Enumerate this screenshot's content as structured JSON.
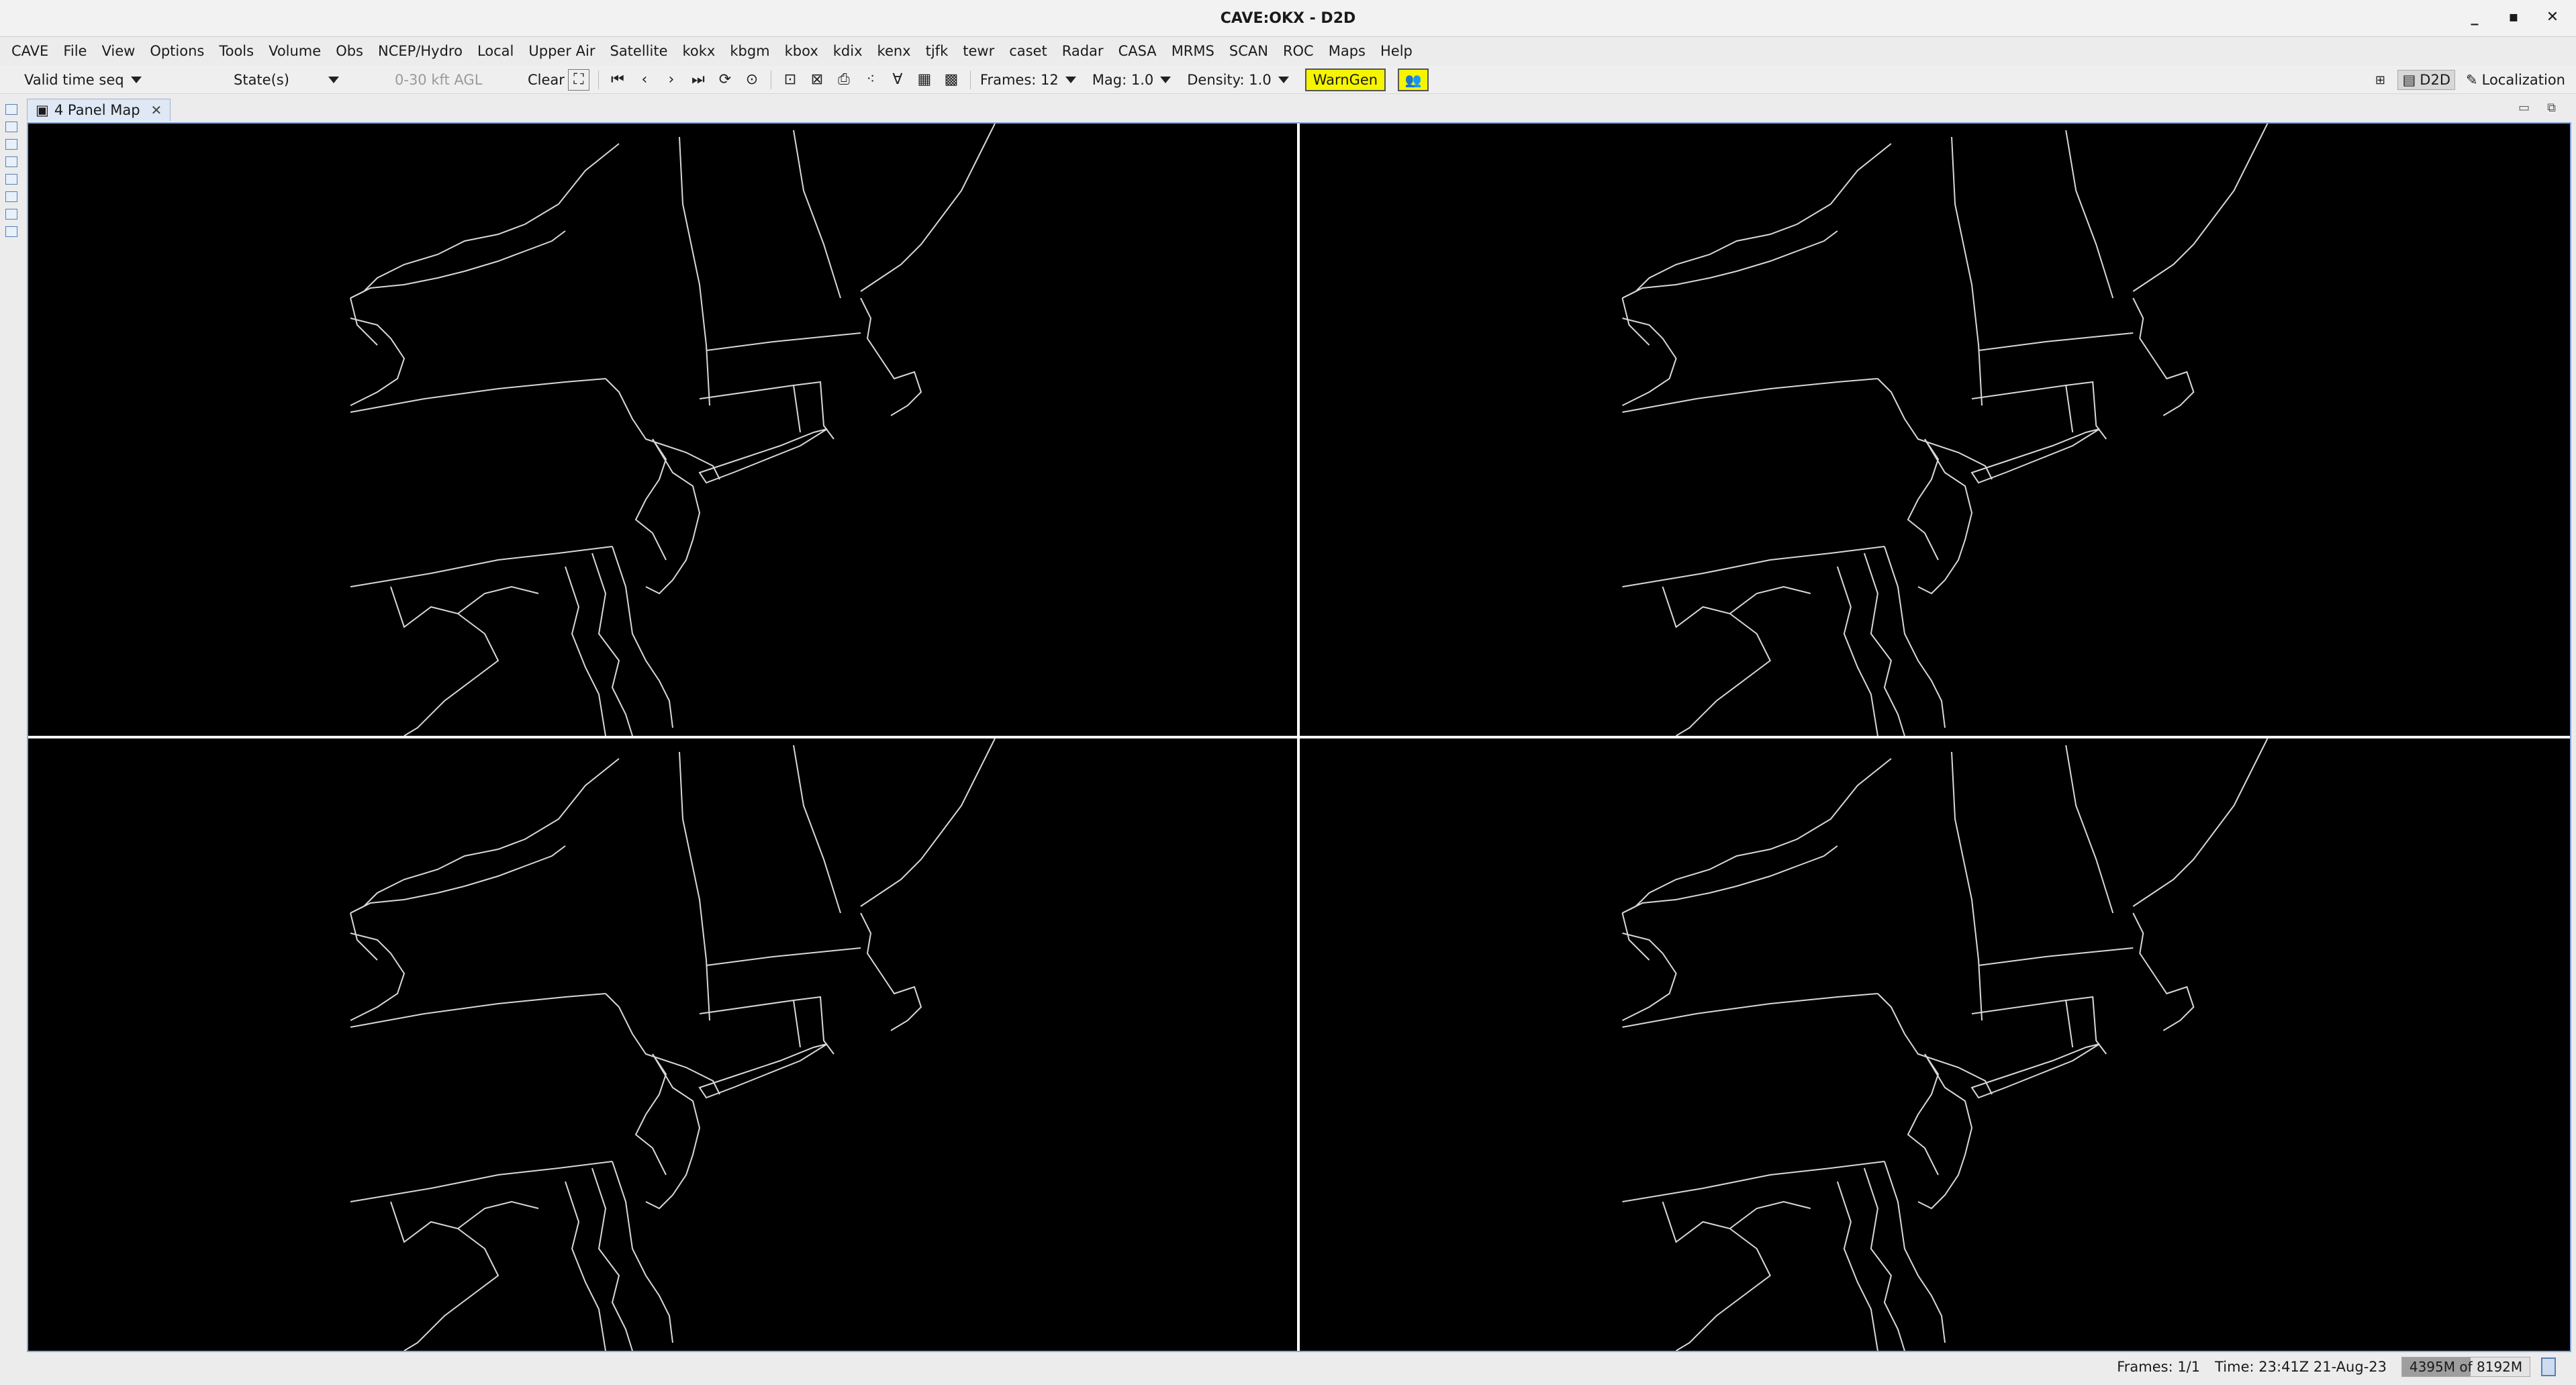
{
  "window": {
    "title": "CAVE:OKX - D2D",
    "controls": [
      "minimize",
      "maximize",
      "close"
    ]
  },
  "menubar": {
    "items": [
      "CAVE",
      "File",
      "View",
      "Options",
      "Tools",
      "Volume",
      "Obs",
      "NCEP/Hydro",
      "Local",
      "Upper Air",
      "Satellite",
      "kokx",
      "kbgm",
      "kbox",
      "kdix",
      "kenx",
      "tjfk",
      "tewr",
      "caset",
      "Radar",
      "CASA",
      "MRMS",
      "SCAN",
      "ROC",
      "Maps",
      "Help"
    ]
  },
  "toolbar": {
    "loop_mode": "Valid time seq",
    "scope": "State(s)",
    "height_filter": "0-30 kft AGL",
    "clear_label": "Clear",
    "frames_label": "Frames: 12",
    "mag_label": "Mag: 1.0",
    "density_label": "Density: 1.0",
    "warngen_label": "WarnGen",
    "accent_color": "#f5f500"
  },
  "perspectives": {
    "active": "D2D",
    "other": "Localization"
  },
  "editor": {
    "tab_label": "4 Panel Map",
    "panel_count": 4
  },
  "status": {
    "frames": "Frames: 1/1",
    "time": "Time: 23:41Z 21-Aug-23",
    "memory_label": "4395M of 8192M",
    "memory_fraction": 0.537
  }
}
